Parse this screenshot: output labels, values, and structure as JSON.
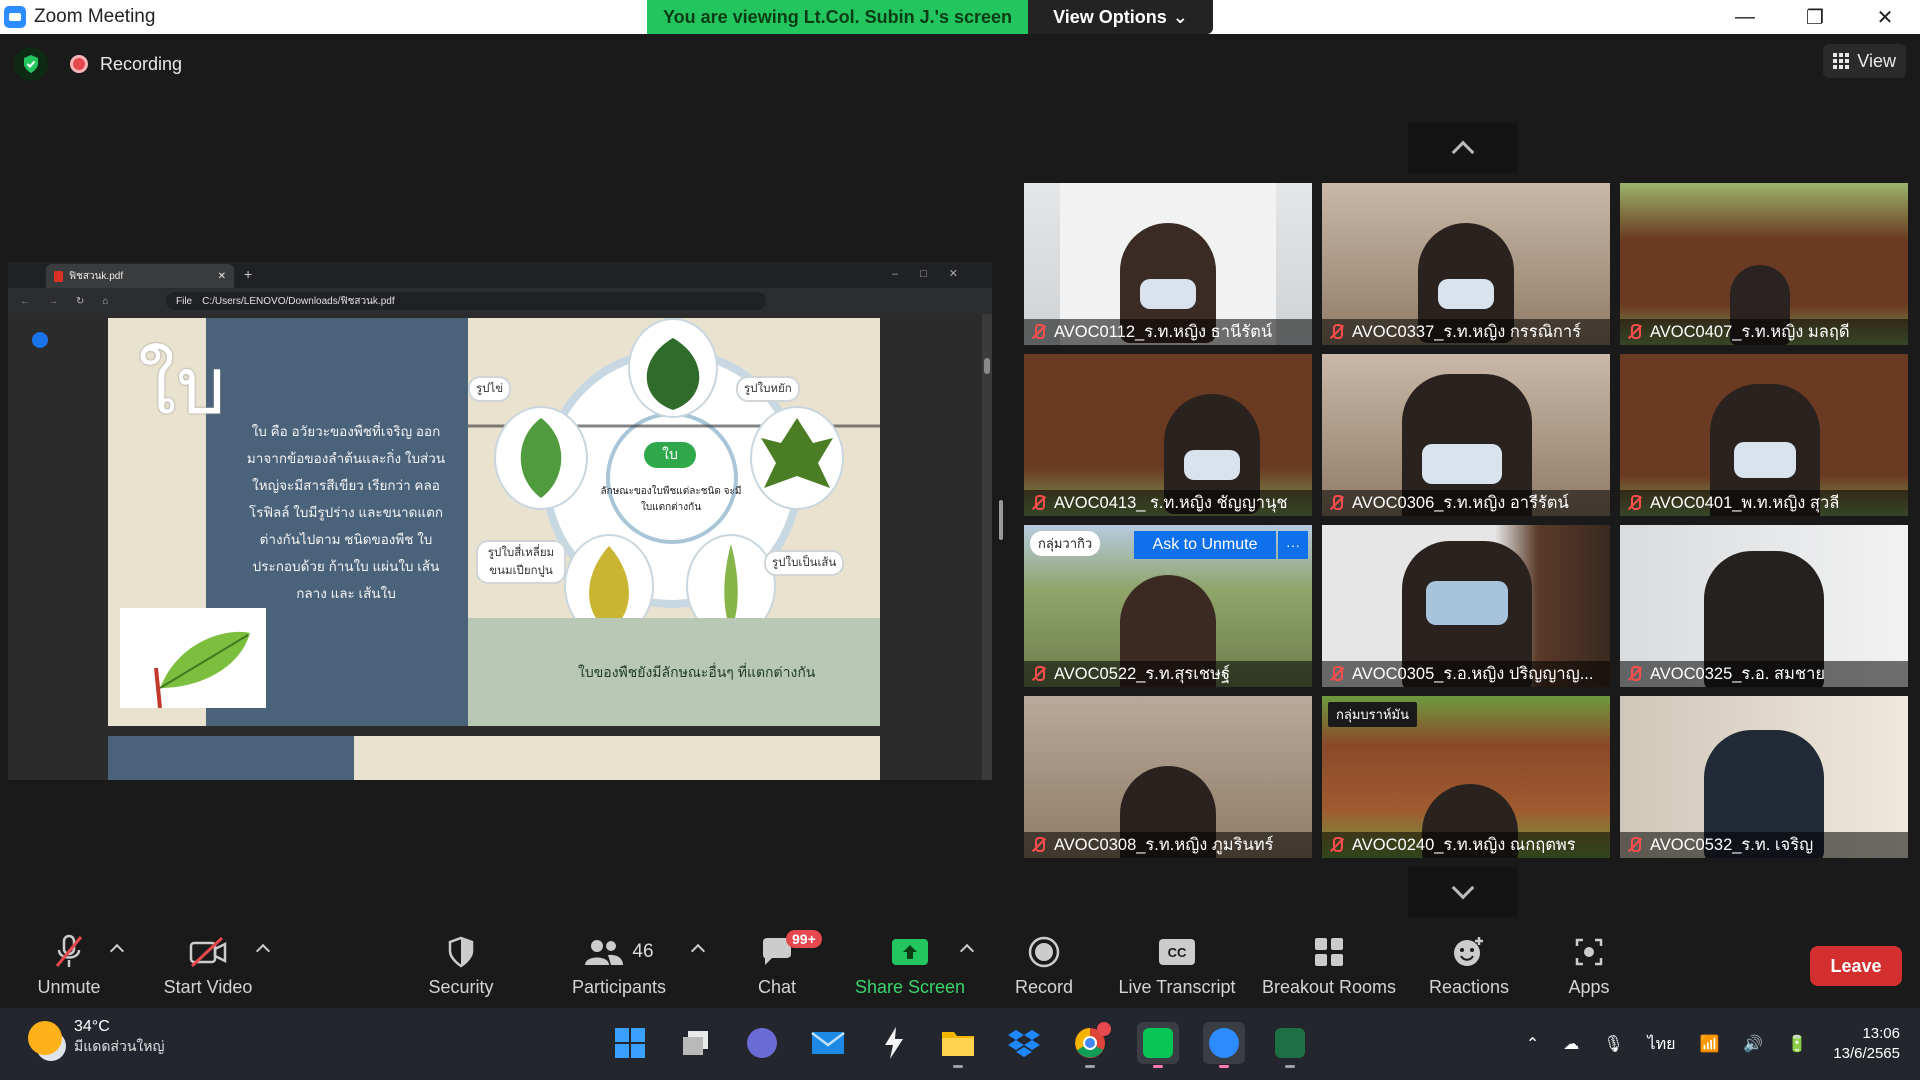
{
  "window": {
    "title": "Zoom Meeting"
  },
  "banner": {
    "viewing": "You are viewing Lt.Col. Subin J.'s screen",
    "view_options": "View Options"
  },
  "meeting": {
    "recording_label": "Recording",
    "view_label": "View"
  },
  "shared_screen": {
    "tab_title": "ฟิชสวนk.pdf",
    "file_label": "File",
    "address": "C:/Users/LENOVO/Downloads/ฟิชสวนk.pdf",
    "slide": {
      "heading": "ใบ",
      "body": "ใบ คือ อวัยวะของพืชที่เจริญ ออกมาจากข้อของลำต้นและกิ่ง ใบส่วนใหญ่จะมีสารสีเขียว เรียกว่า คลอโรฟิลล์ ใบมีรูปร่าง และขนาดแตกต่างกันไปตาม ชนิดของพืช ใบประกอบด้วย ก้านใบ แผ่นใบ เส้นกลาง และ เส้นใบ",
      "center_label": "ใบ",
      "center_sub": "ลักษณะของใบพืชแต่ละชนิด จะมีใบแตกต่างกัน",
      "labels": [
        "รูปไข่",
        "รูปใบหยัก",
        "รูปใบสี่เหลี่ยม ขนมเปียกปูน",
        "รูปใบเป็นเส้น"
      ],
      "caption": "ใบของพืชยังมีลักษณะอื่นๆ ที่แตกต่างกัน"
    }
  },
  "participants_grid": [
    {
      "name": "AVOC0112_ร.ท.หญิง ธานีรัตน์"
    },
    {
      "name": "AVOC0337_ร.ท.หญิง กรรณิการ์"
    },
    {
      "name": "AVOC0407_ร.ท.หญิง มลฤดี"
    },
    {
      "name": "AVOC0413_ ร.ท.หญิง ชัญญานุช"
    },
    {
      "name": "AVOC0306_ร.ท.หญิง อารีรัตน์"
    },
    {
      "name": "AVOC0401_พ.ท.หญิง สุวลี"
    },
    {
      "name": "AVOC0522_ร.ท.สุรเชษฐ์",
      "tag": "กลุ่มวากิว",
      "ask_unmute": "Ask to Unmute",
      "more": "···"
    },
    {
      "name": "AVOC0305_ร.อ.หญิง ปริญญาญ..."
    },
    {
      "name": "AVOC0325_ร.อ. สมชาย"
    },
    {
      "name": "AVOC0308_ร.ท.หญิง ภูมรินทร์"
    },
    {
      "name": "AVOC0240_ร.ท.หญิง ณกฤตพร",
      "tag": "กลุ่มบราห์มัน"
    },
    {
      "name": "AVOC0532_ร.ท. เจริญ"
    }
  ],
  "toolbar": {
    "unmute": "Unmute",
    "start_video": "Start Video",
    "security": "Security",
    "participants": "Participants",
    "participants_count": "46",
    "chat": "Chat",
    "chat_badge": "99+",
    "share_screen": "Share Screen",
    "record": "Record",
    "live_transcript": "Live Transcript",
    "breakout_rooms": "Breakout Rooms",
    "reactions": "Reactions",
    "apps": "Apps",
    "leave": "Leave"
  },
  "taskbar": {
    "temperature": "34°C",
    "weather_desc": "มีแดดส่วนใหญ่",
    "language": "ไทย",
    "time": "13:06",
    "date": "13/6/2565"
  }
}
